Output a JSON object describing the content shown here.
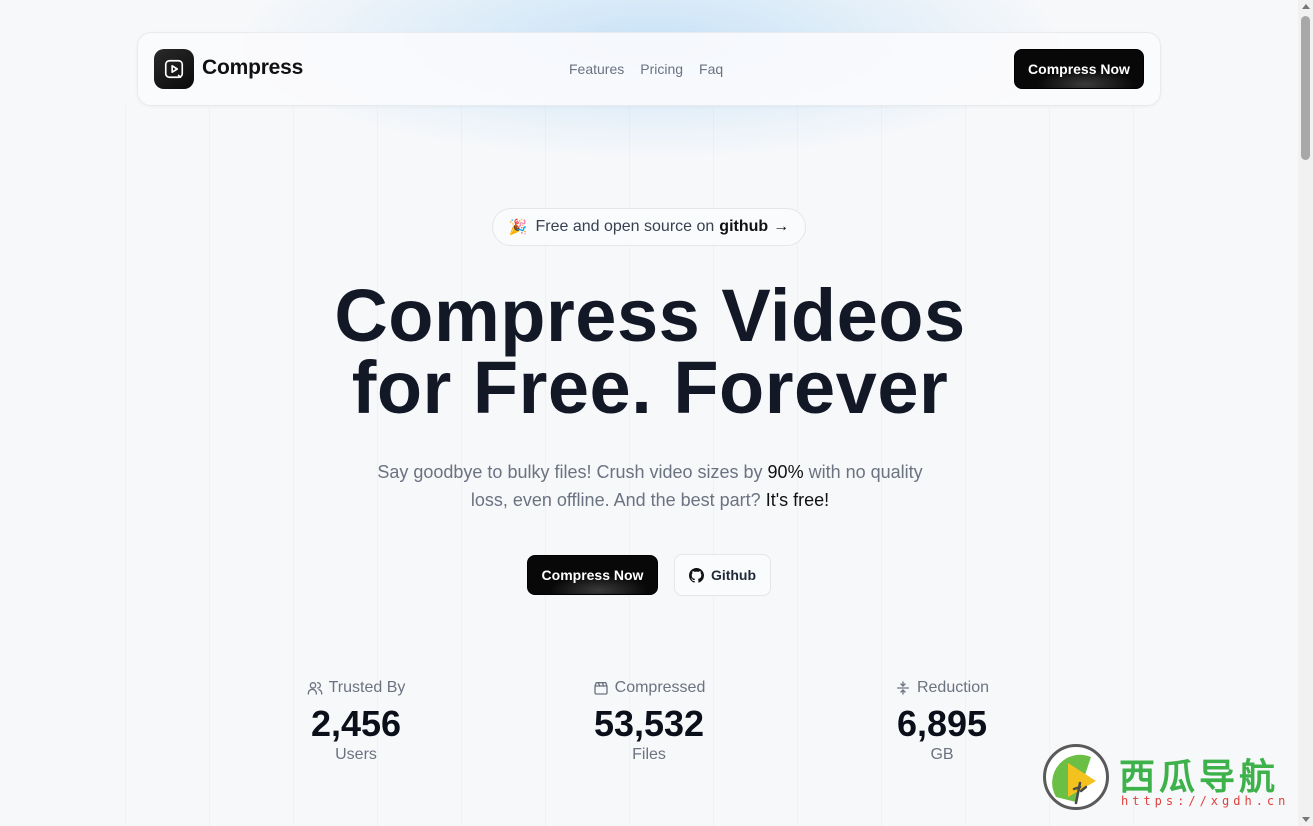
{
  "brand": {
    "name": "Compress",
    "icon": "video-play-icon"
  },
  "nav": {
    "links": [
      "Features",
      "Pricing",
      "Faq"
    ],
    "cta": "Compress Now"
  },
  "hero": {
    "badge": {
      "emoji": "🎉",
      "text": "Free and open source on",
      "link": "github",
      "arrow": "→"
    },
    "headline_line1": "Compress Videos",
    "headline_line2": "for Free. Forever",
    "subtitle": {
      "part1": "Say goodbye to bulky files! Crush video sizes by ",
      "highlight1": "90%",
      "part2": " with no quality loss, even offline. And the best part? ",
      "highlight2": "It's free!"
    },
    "primary_cta": "Compress Now",
    "secondary_cta": "Github"
  },
  "stats": [
    {
      "label": "Trusted By",
      "value": "2,456",
      "unit": "Users",
      "icon": "users-icon"
    },
    {
      "label": "Compressed",
      "value": "53,532",
      "unit": "Files",
      "icon": "clapperboard-icon"
    },
    {
      "label": "Reduction",
      "value": "6,895",
      "unit": "GB",
      "icon": "reduce-icon"
    }
  ],
  "watermark": {
    "title": "西瓜导航",
    "url": "https://xgdh.cn"
  },
  "colors": {
    "accent": "#0a0a0a",
    "text": "#121826",
    "muted": "#6b7280",
    "watermark_green": "#3db24a",
    "watermark_red": "#e0413c"
  }
}
